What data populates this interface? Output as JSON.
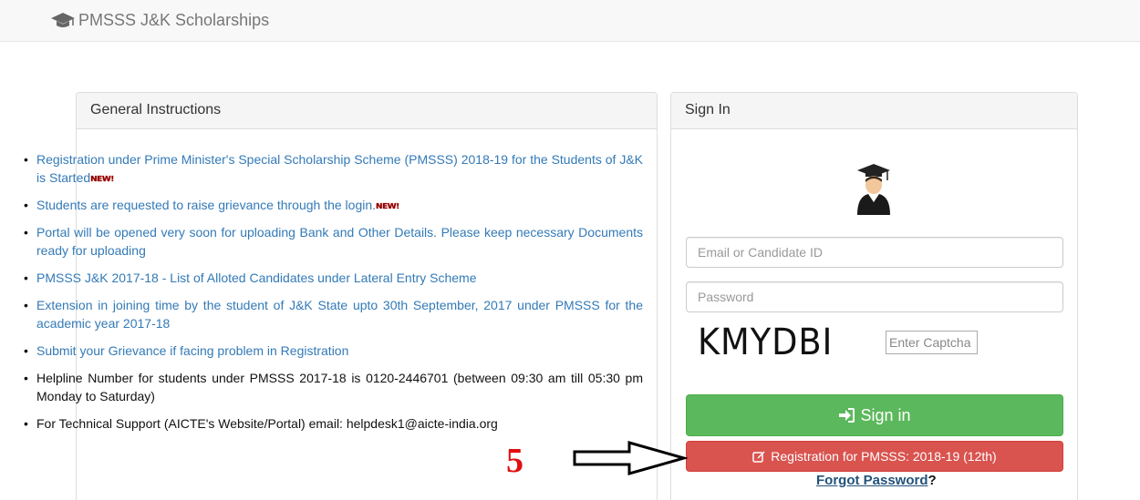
{
  "navbar": {
    "brand": "PMSSS J&K Scholarships",
    "brand_icon": "graduation-cap-icon"
  },
  "instructions": {
    "title": "General Instructions",
    "items": [
      {
        "text": "Registration under Prime Minister's Special Scholarship Scheme (PMSSS) 2018-19 for the Students of J&K is Started",
        "badge": "NEW!",
        "link": true
      },
      {
        "text": "Students are requested to raise grievance through the login.",
        "badge": "NEW!",
        "link": true
      },
      {
        "text": "Portal will be opened very soon for uploading Bank and Other Details. Please keep necessary Documents ready for uploading",
        "link": true
      },
      {
        "text": "PMSSS J&K 2017-18 - List of Alloted Candidates under Lateral Entry Scheme",
        "link": true
      },
      {
        "text": "Extension in joining time by the student of J&K State upto 30th September, 2017 under PMSSS for the academic year 2017-18",
        "link": true
      },
      {
        "text": "Submit your Grievance if facing problem in Registration",
        "link": true
      },
      {
        "text": "Helpline Number for students under PMSSS 2017-18 is 0120-2446701 (between 09:30 am till 05:30 pm Monday to Saturday)",
        "link": false
      },
      {
        "text": "For Technical Support (AICTE's Website/Portal) email: helpdesk1@aicte-india.org",
        "link": false
      }
    ]
  },
  "signin": {
    "title": "Sign In",
    "avatar_icon": "graduate-avatar-icon",
    "email_placeholder": "Email or Candidate ID",
    "email_value": "",
    "password_placeholder": "Password",
    "password_value": "",
    "captcha_text": "KMYDBI",
    "captcha_placeholder": "Enter Captcha",
    "captcha_value": "",
    "signin_label": "Sign in",
    "signin_icon": "sign-in-icon",
    "register_label": "Registration for PMSSS: 2018-19 (12th)",
    "register_icon": "edit-icon",
    "forgot_label": "Forgot Password",
    "forgot_suffix": "?"
  },
  "annotation": {
    "step_number": "5",
    "arrow_icon": "right-arrow-icon"
  },
  "colors": {
    "success": "#5cb85c",
    "danger": "#d9534f",
    "link": "#337ab7",
    "annotation": "#e01010"
  }
}
